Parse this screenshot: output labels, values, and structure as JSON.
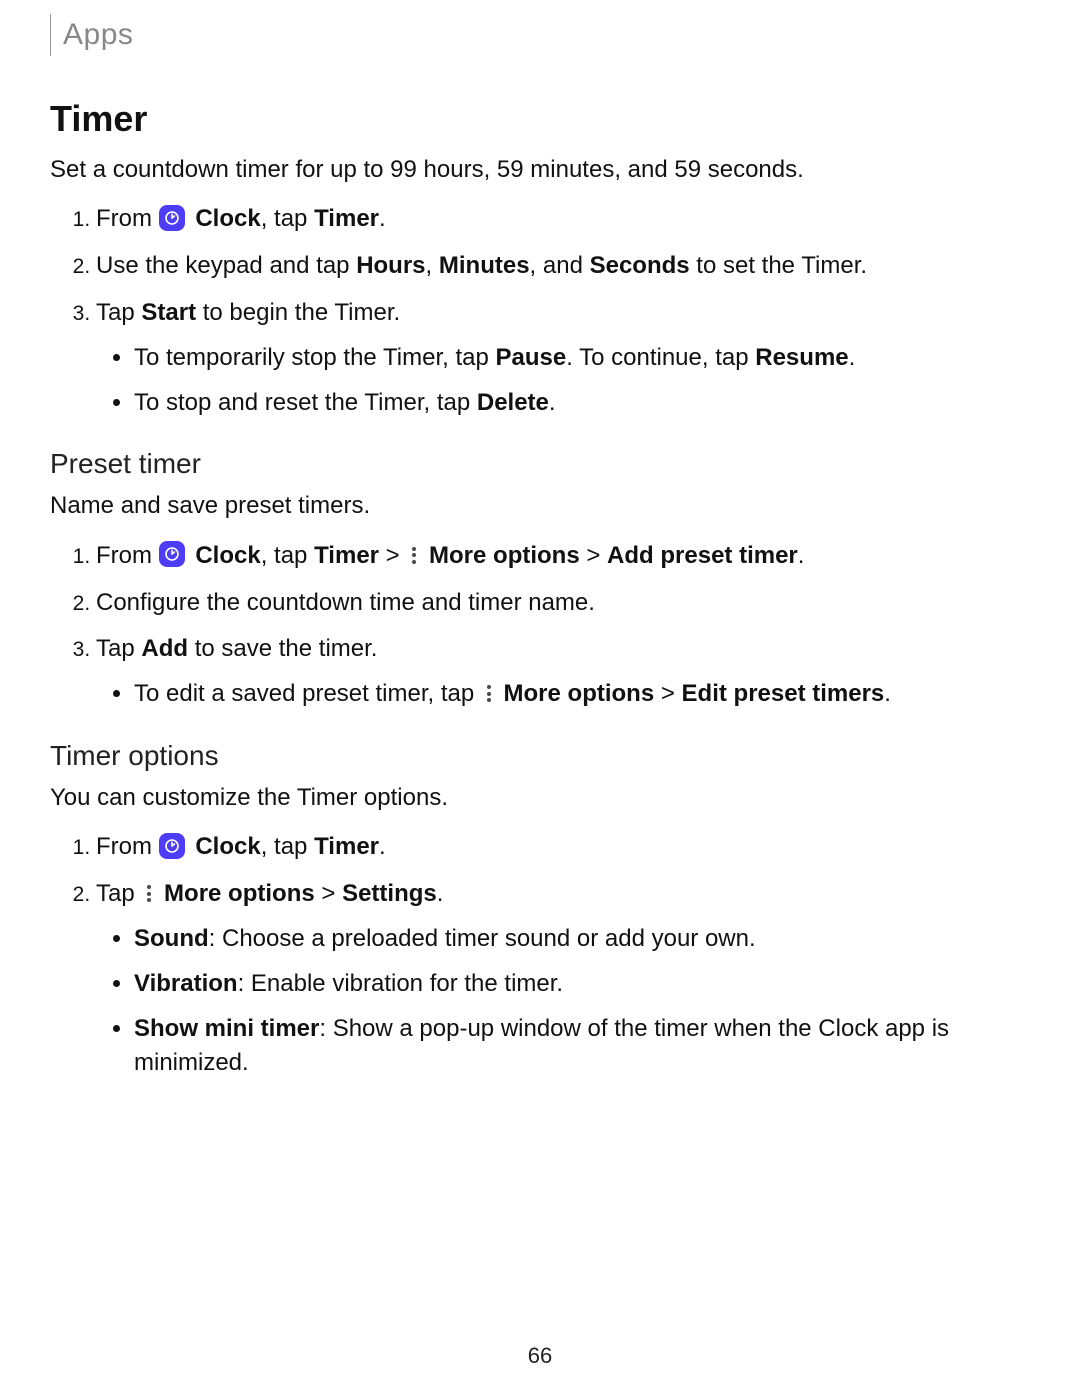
{
  "header": {
    "title": "Apps"
  },
  "pageNumber": "66",
  "section": {
    "title": "Timer",
    "intro": "Set a countdown timer for up to 99 hours, 59 minutes, and 59 seconds.",
    "steps1": {
      "s1": {
        "t1": "From ",
        "b1": "Clock",
        "t2": ", tap ",
        "b2": "Timer",
        "t3": "."
      },
      "s2": {
        "t1": "Use the keypad and tap ",
        "b1": "Hours",
        "t2": ", ",
        "b2": "Minutes",
        "t3": ", and ",
        "b3": "Seconds",
        "t4": " to set the Timer."
      },
      "s3": {
        "t1": "Tap ",
        "b1": "Start",
        "t2": " to begin the Timer.",
        "sub1": {
          "t1": "To temporarily stop the Timer, tap ",
          "b1": "Pause",
          "t2": ". To continue, tap ",
          "b2": "Resume",
          "t3": "."
        },
        "sub2": {
          "t1": "To stop and reset the Timer, tap ",
          "b1": "Delete",
          "t2": "."
        }
      }
    }
  },
  "preset": {
    "title": "Preset timer",
    "intro": "Name and save preset timers.",
    "s1": {
      "t1": "From ",
      "b1": "Clock",
      "t2": ", tap ",
      "b2": "Timer",
      "t3": " > ",
      "b3": "More options",
      "t4": " > ",
      "b4": "Add preset timer",
      "t5": "."
    },
    "s2": "Configure the countdown time and timer name.",
    "s3": {
      "t1": "Tap ",
      "b1": "Add",
      "t2": " to save the timer.",
      "sub1": {
        "t1": "To edit a saved preset timer, tap ",
        "b1": "More options",
        "t2": " > ",
        "b2": "Edit preset timers",
        "t3": "."
      }
    }
  },
  "options": {
    "title": "Timer options",
    "intro": "You can customize the Timer options.",
    "s1": {
      "t1": "From ",
      "b1": "Clock",
      "t2": ", tap ",
      "b2": "Timer",
      "t3": "."
    },
    "s2": {
      "t1": "Tap ",
      "b1": "More options",
      "t2": " > ",
      "b2": "Settings",
      "t3": ".",
      "sub1": {
        "b1": "Sound",
        "t1": ": Choose a preloaded timer sound or add your own."
      },
      "sub2": {
        "b1": "Vibration",
        "t1": ": Enable vibration for the timer."
      },
      "sub3": {
        "b1": "Show mini timer",
        "t1": ": Show a pop-up window of the timer when the Clock app is minimized."
      }
    }
  }
}
